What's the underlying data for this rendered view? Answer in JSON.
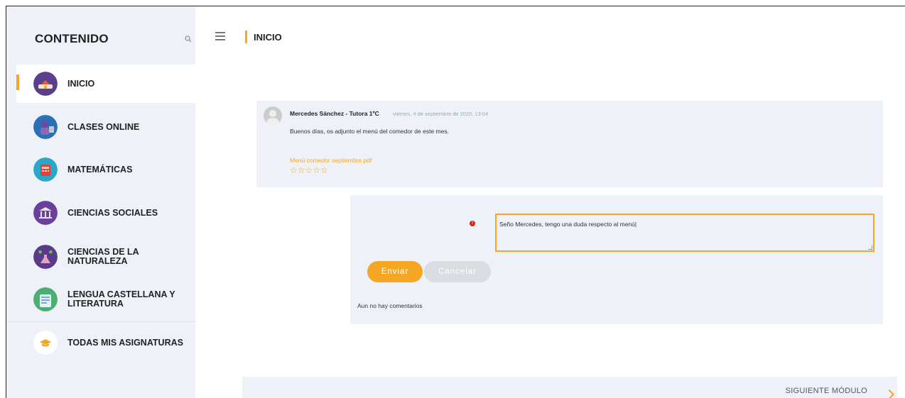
{
  "sidebar": {
    "title": "CONTENIDO",
    "search_icon": "search-icon",
    "items": [
      {
        "label": "INICIO",
        "icon": "home-icon",
        "active": true,
        "color": "#5b3f8c"
      },
      {
        "label": "CLASES ONLINE",
        "icon": "online-class-icon",
        "active": false,
        "color": "#2b6fb6"
      },
      {
        "label": "MATEMÁTICAS",
        "icon": "math-icon",
        "active": false,
        "color": "#2aa7c9"
      },
      {
        "label": "CIENCIAS SOCIALES",
        "icon": "social-sciences-icon",
        "active": false,
        "color": "#6b3f9c"
      },
      {
        "label": "CIENCIAS DE LA NATURALEZA",
        "icon": "natural-sciences-icon",
        "active": false,
        "color": "#5a3a8a"
      },
      {
        "label": "LENGUA CASTELLANA Y LITERATURA",
        "icon": "language-icon",
        "active": false,
        "color": "#4caf72"
      },
      {
        "label": "TODAS MIS ASIGNATURAS",
        "icon": "graduation-cap-icon",
        "active": false,
        "color": "#f5a623"
      }
    ]
  },
  "header": {
    "menu_icon": "hamburger-icon",
    "breadcrumb": "INICIO"
  },
  "post": {
    "author": "Mercedes Sánchez - Tutora 1ºC",
    "date": "viernes, 4 de septiembre de 2020, 13:04",
    "text": "Buenos días, os adjunto el menú del comedor de este mes.",
    "attachment": "Menú comedor septiembre.pdf",
    "rating_stars": "☆☆☆☆☆"
  },
  "reply": {
    "value": "Seño Mercedes, tengo una duda respecto al menú|",
    "error_icon": "!",
    "send_label": "Enviar",
    "cancel_label": "Cancelar",
    "no_comments": "Aun no hay comentarios"
  },
  "footer": {
    "next_label": "SIGUIENTE MÓDULO"
  },
  "colors": {
    "accent": "#f5a623",
    "panel_bg": "#eef2f8",
    "error": "#d9230f"
  }
}
